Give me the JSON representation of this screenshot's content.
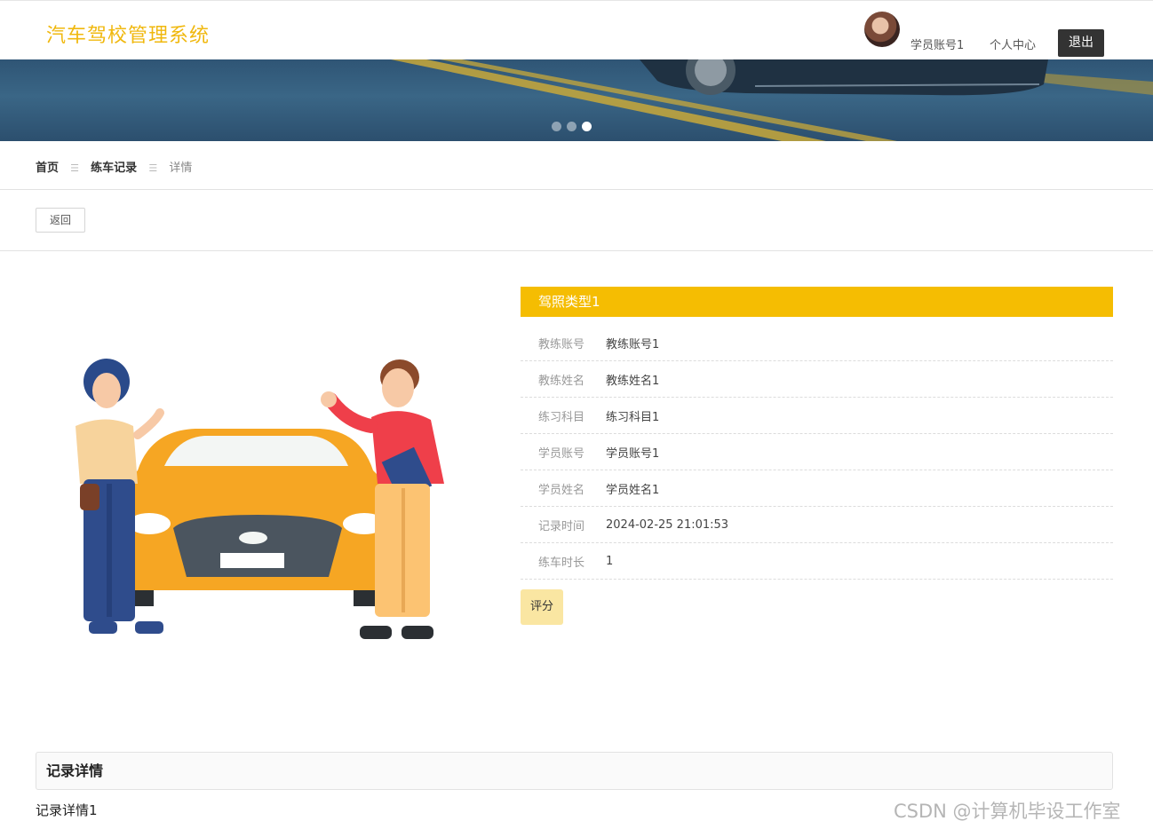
{
  "header": {
    "logo": "汽车驾校管理系统",
    "username": "学员账号1",
    "profile_link": "个人中心",
    "logout": "退出"
  },
  "banner": {
    "slide_count": 3,
    "active_slide": 3
  },
  "breadcrumb": {
    "home": "首页",
    "section": "练车记录",
    "current": "详情",
    "separator": "☰"
  },
  "actions": {
    "back": "返回",
    "rate": "评分"
  },
  "detail": {
    "title": "驾照类型1",
    "fields": [
      {
        "label": "教练账号",
        "value": "教练账号1"
      },
      {
        "label": "教练姓名",
        "value": "教练姓名1"
      },
      {
        "label": "练习科目",
        "value": "练习科目1"
      },
      {
        "label": "学员账号",
        "value": "学员账号1"
      },
      {
        "label": "学员姓名",
        "value": "学员姓名1"
      },
      {
        "label": "记录时间",
        "value": "2024-02-25 21:01:53"
      },
      {
        "label": "练车时长",
        "value": "1"
      }
    ]
  },
  "record": {
    "heading": "记录详情",
    "content": "记录详情1"
  },
  "watermark": "CSDN @计算机毕设工作室",
  "colors": {
    "brand": "#f0b80e",
    "panel_header": "#f5bd02",
    "rate_button": "#fae6a2",
    "logout_button": "#333333"
  }
}
